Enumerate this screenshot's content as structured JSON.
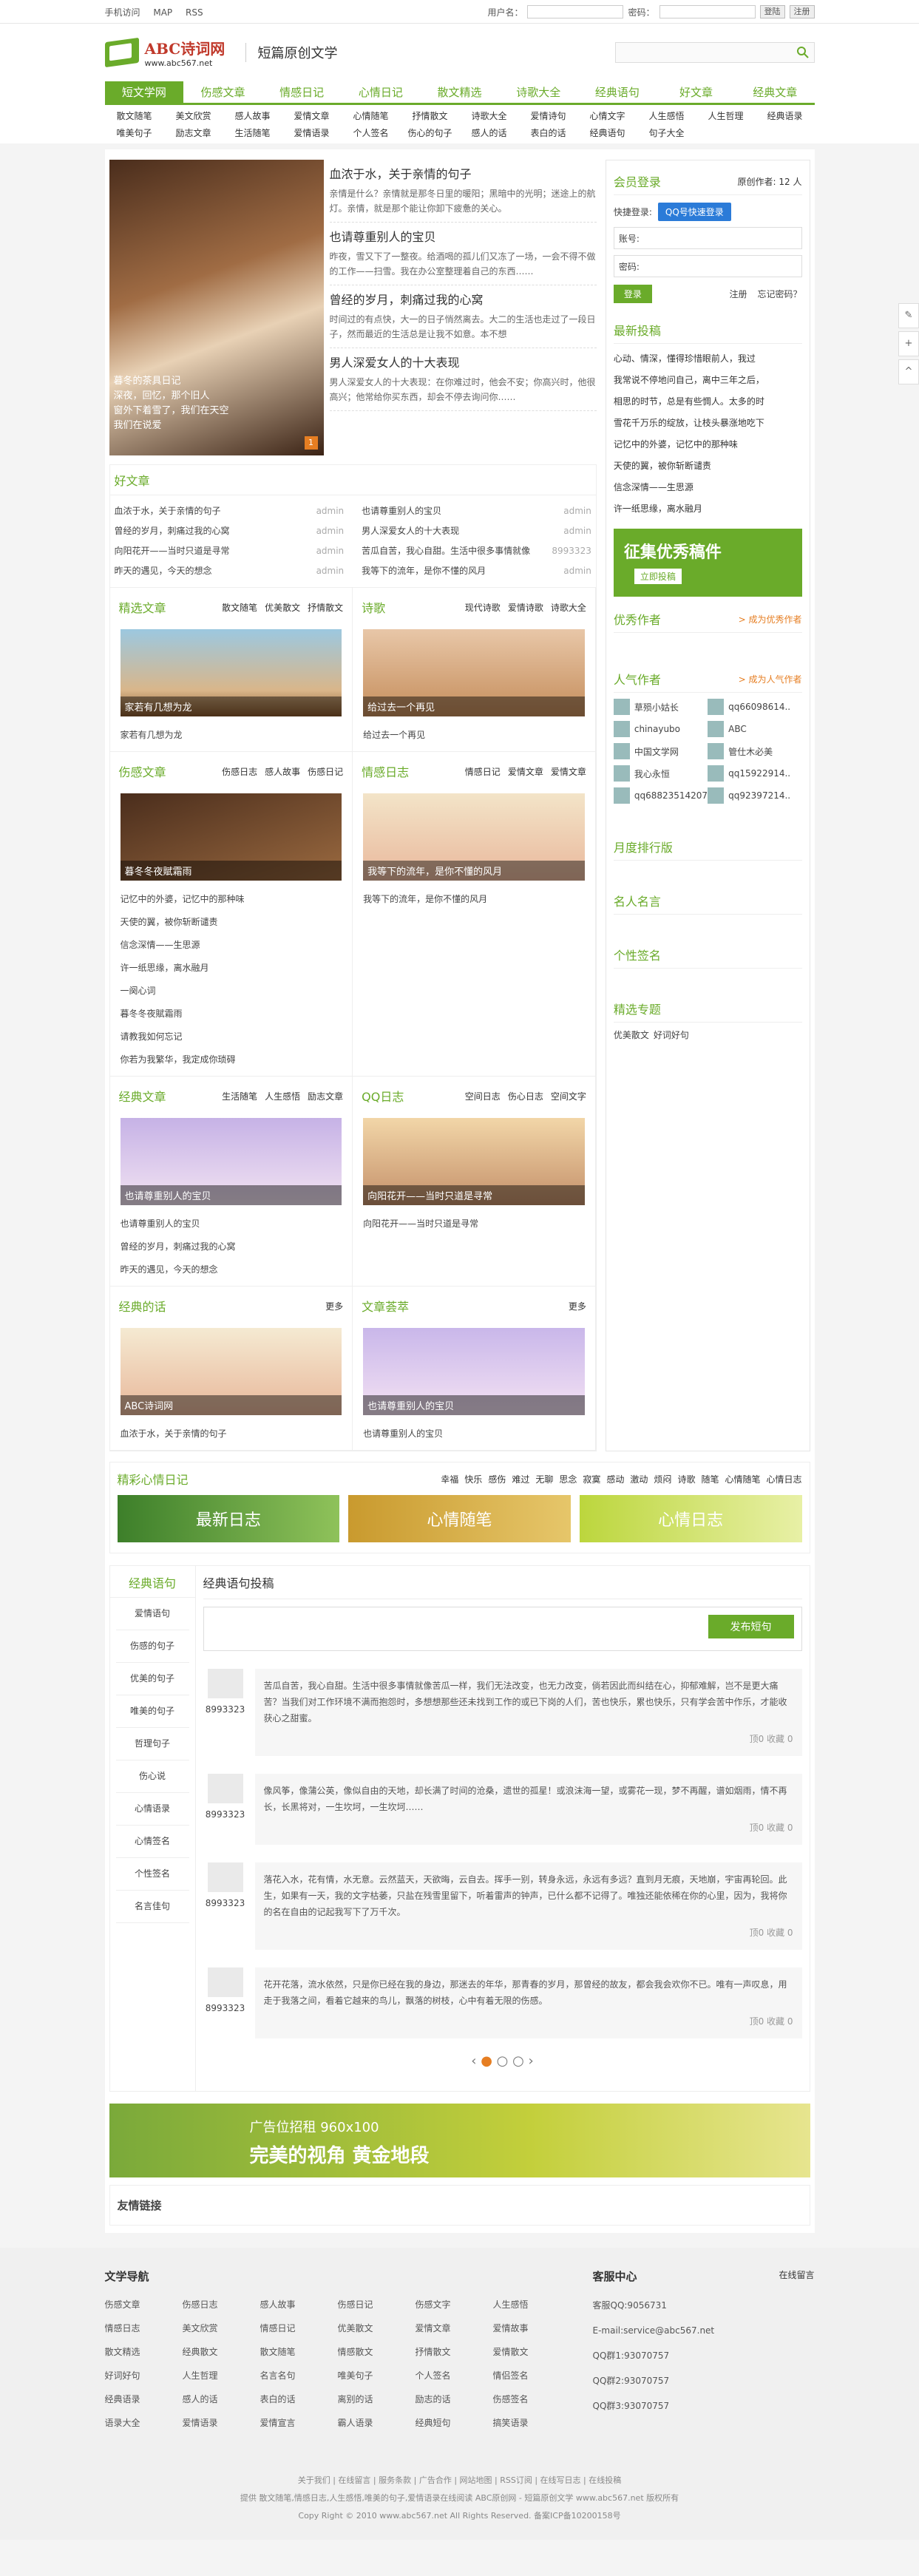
{
  "topbar": {
    "links": [
      "手机访问",
      "MAP",
      "RSS"
    ],
    "user_label": "用户名：",
    "pass_label": "密码：",
    "login": "登陆",
    "register": "注册"
  },
  "header": {
    "logo_name": "ABC诗词网",
    "logo_url": "www.abc567.net",
    "slogan": "短篇原创文学"
  },
  "nav": {
    "items": [
      "短文学网",
      "伤感文章",
      "情感日记",
      "心情日记",
      "散文精选",
      "诗歌大全",
      "经典语句",
      "好文章",
      "经典文章"
    ]
  },
  "subnav": [
    "散文随笔",
    "美文欣赏",
    "感人故事",
    "爱情文章",
    "心情随笔",
    "抒情散文",
    "诗歌大全",
    "爱情诗句",
    "心情文字",
    "人生感悟",
    "人生哲理",
    "经典语录",
    "唯美句子",
    "励志文章",
    "生活随笔",
    "爱情语录",
    "个人签名",
    "伤心的句子",
    "感人的话",
    "表白的话",
    "经典语句",
    "句子大全"
  ],
  "hero": {
    "img_caption": "暮冬的茶具日记\n深夜，回忆，那个旧人\n窗外下着雪了，我们在天空\n我们在说爱",
    "img_num": "1",
    "items": [
      {
        "title": "血浓于水，关于亲情的句子",
        "desc": "亲情是什么？亲情就是那冬日里的暖阳；黑暗中的光明；迷途上的航灯。亲情，就是那个能让你卸下疲惫的关心。"
      },
      {
        "title": "也请尊重别人的宝贝",
        "desc": "昨夜，雪又下了一整夜。给酒喝的孤儿们又冻了一场，一会不得不做的工作——扫雪。我在办公室整理着自己的东西……"
      },
      {
        "title": "曾经的岁月，刺痛过我的心窝",
        "desc": "时间过的有点快，大一的日子悄然离去。大二的生活也走过了一段日子，然而最近的生活总是让我不如意。本不想"
      },
      {
        "title": "男人深爱女人的十大表现",
        "desc": "男人深爱女人的十大表现：在你难过时，他会不安；你高兴时，他很高兴；他常给你买东西，却会不停去询问你……"
      }
    ]
  },
  "good": {
    "title": "好文章",
    "rows": [
      {
        "t": "血浓于水，关于亲情的句子",
        "a": "admin"
      },
      {
        "t": "也请尊重别人的宝贝",
        "a": "admin"
      },
      {
        "t": "曾经的岁月，刺痛过我的心窝",
        "a": "admin"
      },
      {
        "t": "男人深爱女人的十大表现",
        "a": "admin"
      },
      {
        "t": "向阳花开——当时只道是寻常",
        "a": "admin"
      },
      {
        "t": "苦瓜自苦，我心自甜。生活中很多事情就像",
        "a": "8993323"
      },
      {
        "t": "昨天的遇见，今天的想念",
        "a": "admin"
      },
      {
        "t": "我等下的流年，是你不懂的风月",
        "a": "admin"
      }
    ]
  },
  "cells": [
    {
      "title": "精选文章",
      "tabs": [
        "散文随笔",
        "优美散文",
        "抒情散文"
      ],
      "pic": "家若有几想为龙",
      "lines": [
        "家若有几想为龙"
      ]
    },
    {
      "title": "诗歌",
      "tabs": [
        "现代诗歌",
        "爱情诗歌",
        "诗歌大全"
      ],
      "pic": "给过去一个再见",
      "lines": [
        "给过去一个再见"
      ]
    },
    {
      "title": "伤感文章",
      "tabs": [
        "伤感日志",
        "感人故事",
        "伤感日记"
      ],
      "pic": "暮冬冬夜賦霜雨",
      "lines": [
        "记忆中的外婆，记忆中的那种味",
        "天使的翼，被你斩断谴责",
        "信念深情——生思源",
        "许一纸思缘，离水融月",
        "一阕心词",
        "暮冬冬夜賦霜雨",
        "请教我如何忘记",
        "你若为我繁华，我定成你琐碍"
      ]
    },
    {
      "title": "情感日志",
      "tabs": [
        "情感日记",
        "爱情文章",
        "爱情文章"
      ],
      "pic": "我等下的流年，是你不懂的风月",
      "lines": [
        "我等下的流年，是你不懂的风月"
      ]
    },
    {
      "title": "经典文章",
      "tabs": [
        "生活随笔",
        "人生感悟",
        "励志文章"
      ],
      "pic": "也请尊重别人的宝贝",
      "lines": [
        "也请尊重别人的宝贝",
        "曾经的岁月，刺痛过我的心窝",
        "昨天的遇见，今天的想念"
      ]
    },
    {
      "title": "QQ日志",
      "tabs": [
        "空间日志",
        "伤心日志",
        "空间文字"
      ],
      "pic": "向阳花开——当时只道是寻常",
      "lines": [
        "向阳花开——当时只道是寻常"
      ]
    },
    {
      "title": "经典的话",
      "tabs": [
        "更多"
      ],
      "pic": "ABC诗词网",
      "lines": [
        "血浓于水，关于亲情的句子"
      ]
    },
    {
      "title": "文章荟萃",
      "tabs": [
        "更多"
      ],
      "pic": "也请尊重别人的宝贝",
      "lines": [
        "也请尊重别人的宝贝"
      ]
    }
  ],
  "right": {
    "login_title": "会员登录",
    "author_count": "原创作者: 12 人",
    "quick": "快捷登录:",
    "qq": "QQ号快速登录",
    "acct_label": "账号:",
    "pass_label": "密码:",
    "login_btn": "登录",
    "register": "注册",
    "forgot": "忘记密码？",
    "latest_title": "最新投稿",
    "latest": [
      "心动、情深，懂得珍惜眼前人，我过",
      "我常说不停地问自己，离中三年之后，",
      "相思的时节，总是有些惆人。太多的时",
      "雪花千万乐的绽放，让枝头暴涨地吃下",
      "记忆中的外婆，记忆中的那种味",
      "天使的翼，被你斩断谴责",
      "信念深情——生思源",
      "许一纸思缘，离水融月"
    ],
    "banner1": "征集优秀稿件",
    "banner2": "立即投稿",
    "authors_title": "优秀作者",
    "authors_link": "> 成为优秀作者",
    "popular_title": "人气作者",
    "popular_link": "> 成为人气作者",
    "users": [
      "草殒小姑长",
      "qq66098614..",
      "chinayubo",
      "ABC",
      "中国文学网",
      "管仕木必美",
      "我心永恒",
      "qq15922914..",
      "qq68823514207",
      "qq92397214.."
    ],
    "rank": "月度排行版",
    "names": "名人名言",
    "sign": "个性签名",
    "topic": "精选专题",
    "topics": [
      "优美散文",
      "好词好句"
    ]
  },
  "mood": {
    "title": "精彩心情日记",
    "tags": [
      "幸福",
      "快乐",
      "感伤",
      "难过",
      "无聊",
      "思念",
      "寂寞",
      "感动",
      "激动",
      "烦闷",
      "诗歌",
      "随笔",
      "心情随笔",
      "心情日志"
    ],
    "pics": [
      "最新日志",
      "心情随笔",
      "心情日志"
    ]
  },
  "quote": {
    "side_title": "经典语句",
    "side_items": [
      "爱情语句",
      "伤感的句子",
      "优美的句子",
      "唯美的句子",
      "哲理句子",
      "伤心说",
      "心情语录",
      "心情签名",
      "个性签名",
      "名言佳句"
    ],
    "main_title": "经典语句投稿",
    "post_btn": "发布短句",
    "items": [
      {
        "u": "8993323",
        "t": "苦瓜自苦，我心自甜。生活中很多事情就像苦瓜一样，我们无法改变，也无力改变，倘若因此而纠结在心，抑郁难解，岂不是更大痛苦？当我们对工作环境不满而抱怨时，多想想那些还未找到工作的或已下岗的人们，苦也快乐，累也快乐，只有学会苦中作乐，才能收获心之甜蜜。",
        "act": "顶0  收藏 0"
      },
      {
        "u": "8993323",
        "t": "像风筝，像蒲公英，像似自由的天地，却长满了时间的沧桑，遗世的孤星！或浪沫海一望，或雾花一现，梦不再醒，谱如烟雨，情不再长，长黑将对，一生坎坷，一生坎坷……",
        "act": "顶0  收藏 0"
      },
      {
        "u": "8993323",
        "t": "落花入水，花有情，水无意。云然蓝天，天欲晦，云自去。挥手一别，转身永远，永远有多远？直到月无痕，天地崩，宇宙再轮回。此生，如果有一天，我的文字枯萎，只盐在残雪里留下，听着雷声的钟声，已什么都不记得了。唯独还能依稀在你的心里，因为，我将你的名在自由的记起我写下了万千次。",
        "act": "顶0  收藏 0"
      },
      {
        "u": "8993323",
        "t": "花开花落，流水依然，只是你已经在我的身边，那迷去的年华，那青春的岁月，那曾经的故友，都会我会欢你不已。唯有一声叹息，用走于我落之间，看着它越来的鸟儿，飘落的树枝，心中有着无限的伤感。",
        "act": "顶0  收藏 0"
      }
    ]
  },
  "ad": {
    "l1": "广告位招租 960x100",
    "l2": "完美的视角  黄金地段"
  },
  "friend": "友情链接",
  "footer": {
    "nav_title": "文学导航",
    "nav": [
      "伤感文章",
      "伤感日志",
      "感人故事",
      "伤感日记",
      "伤感文字",
      "人生感悟",
      "情感日志",
      "美文欣赏",
      "情感日记",
      "优美散文",
      "爱情文章",
      "爱情故事",
      "散文精选",
      "经典散文",
      "散文随笔",
      "情感散文",
      "抒情散文",
      "爱情散文",
      "好词好句",
      "人生哲理",
      "名言名句",
      "唯美句子",
      "个人签名",
      "情侣签名",
      "经典语录",
      "感人的话",
      "表白的话",
      "离别的话",
      "励志的话",
      "伤感签名",
      "语录大全",
      "爱情语录",
      "爱情宣言",
      "霸人语录",
      "经典短句",
      "搞笑语录"
    ],
    "svc_title": "客服中心",
    "svc_msg": "在线留言",
    "svc": [
      "客服QQ:9056731",
      "E-mail:service@abc567.net",
      "QQ群1:93070757",
      "QQ群2:93070757",
      "QQ群3:93070757"
    ],
    "links": "关于我们 | 在线留言 | 服务条款 | 广告合作 | 网站地图 | RSS订阅 | 在线写日志 | 在线投稿",
    "desc": "提供 散文随笔,情感日志,人生感悟,唯美的句子,爱情语录在线阅读 ABC原创网 - 短篇原创文学 www.abc567.net 版权所有",
    "copy": "Copy Right © 2010 www.abc567.net All Rights Reserved. 备案ICP备10200158号"
  }
}
